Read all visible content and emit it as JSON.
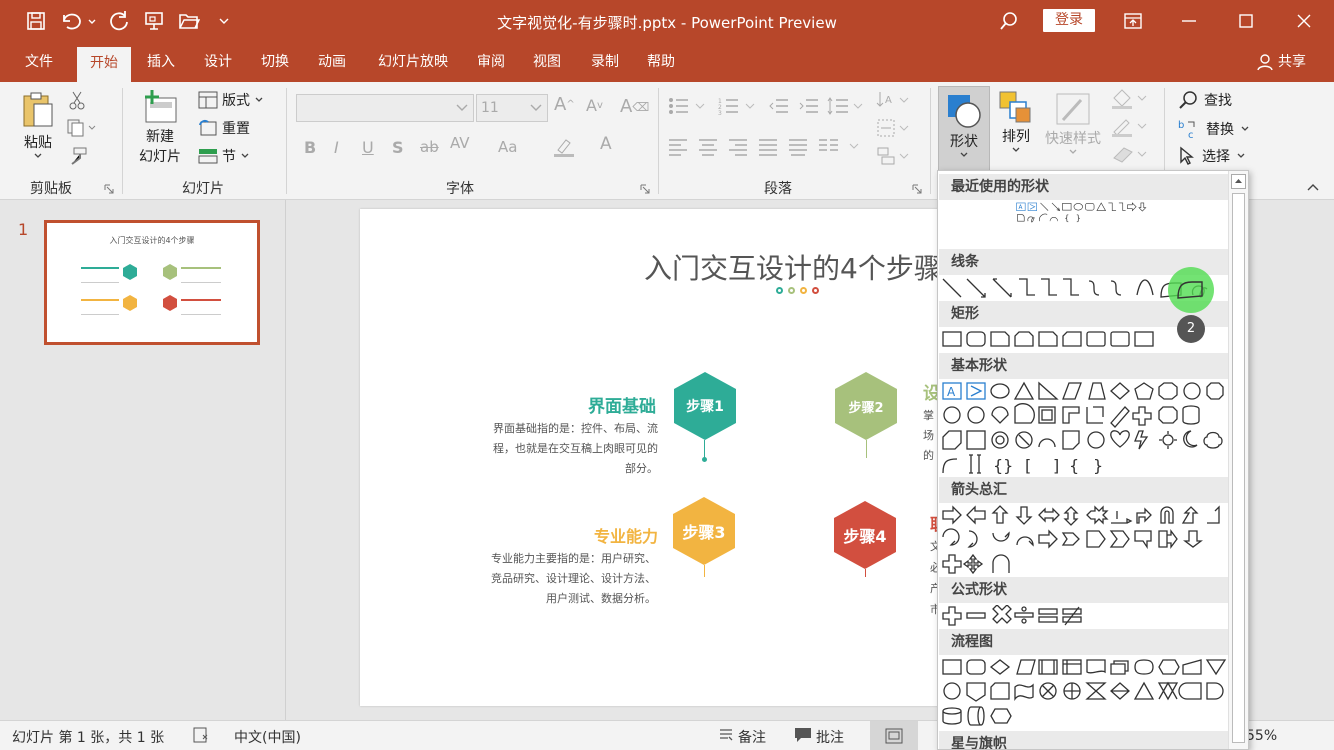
{
  "window": {
    "title": "文字视觉化-有步骤时.pptx  -  PowerPoint Preview",
    "login": "登录"
  },
  "tabs": [
    "文件",
    "开始",
    "插入",
    "设计",
    "切换",
    "动画",
    "幻灯片放映",
    "审阅",
    "视图",
    "录制",
    "帮助"
  ],
  "share": "共享",
  "ribbon": {
    "paste": "粘贴",
    "clipboard": "剪贴板",
    "new_slide_line1": "新建",
    "new_slide_line2": "幻灯片",
    "layout": "版式",
    "reset": "重置",
    "section": "节",
    "slides": "幻灯片",
    "font_size": "11",
    "font": "字体",
    "paragraph": "段落",
    "shapes": "形状",
    "arrange": "排列",
    "quick_styles": "快速样式",
    "find": "查找",
    "replace": "替换",
    "select": "选择"
  },
  "thumb": {
    "number": "1",
    "title": "入门交互设计的4个步骤"
  },
  "slide": {
    "title": "入门交互设计的4个步骤",
    "step1": "步骤1",
    "step2": "步骤2",
    "step3": "步骤3",
    "step4": "步骤4",
    "h1": "界面基础",
    "t1a": "界面基础指的是：控件、布局、流",
    "t1b": "程，也就是在交互稿上肉眼可见的",
    "t1c": "部分。",
    "h3": "专业能力",
    "t3a": "专业能力主要指的是：用户研究、",
    "t3b": "竞品研究、设计理论、设计方法、",
    "t3c": "用户测试、数据分析。",
    "h2_partial": "设",
    "t2a": "掌",
    "t2b": "场",
    "t2c": "的",
    "h4_partial": "职",
    "t4a": "文",
    "t4b": "必",
    "t4c": "产",
    "t4d": "市"
  },
  "shapes_menu": {
    "recent": "最近使用的形状",
    "lines": "线条",
    "rect": "矩形",
    "basic": "基本形状",
    "arrows": "箭头总汇",
    "equation": "公式形状",
    "flowchart": "流程图",
    "stars": "星与旗帜",
    "badge": "2"
  },
  "status": {
    "slide_info": "幻灯片 第 1 张，共 1 张",
    "lang": "中文(中国)",
    "notes": "备注",
    "comments": "批注",
    "zoom": "55%"
  },
  "colors": {
    "accent": "#b7472a",
    "teal": "#2eac97",
    "green": "#a7c17c",
    "orange": "#f2b441",
    "red": "#d24f3f"
  }
}
